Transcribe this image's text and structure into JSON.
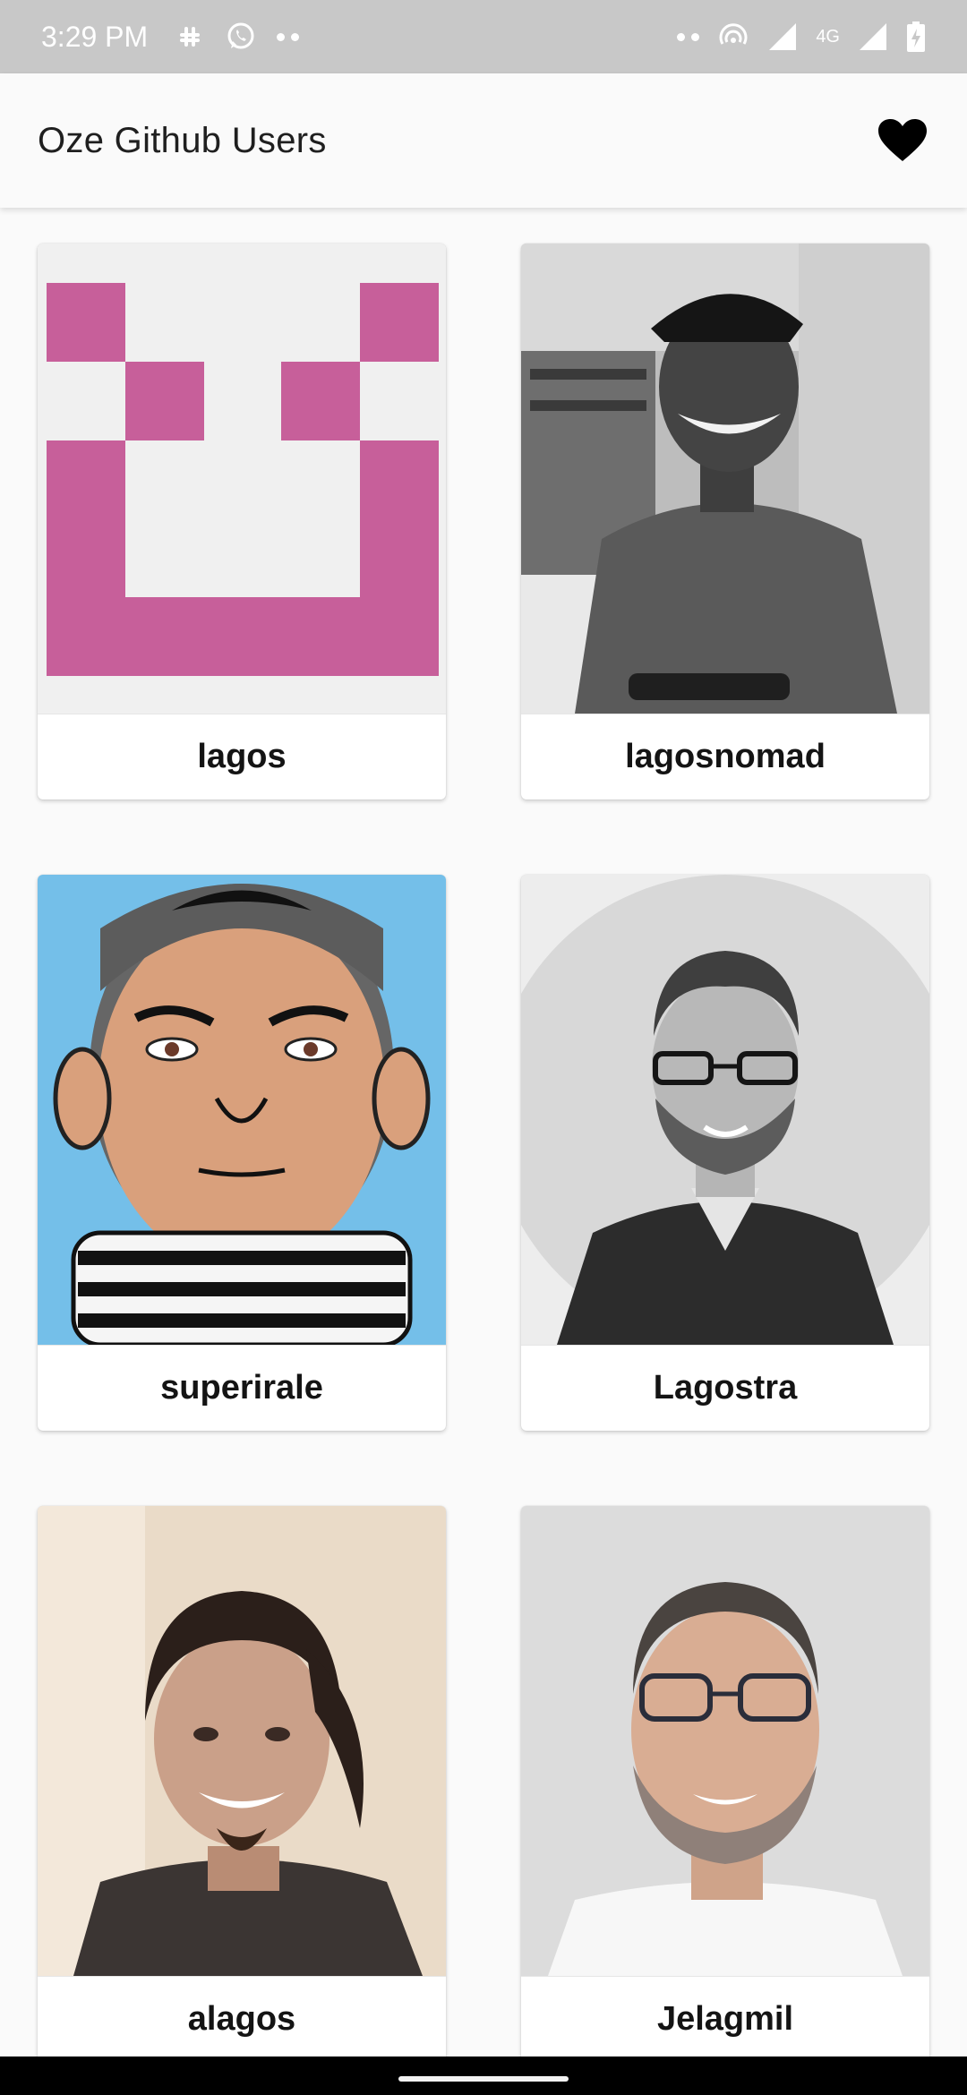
{
  "status_bar": {
    "time": "3:29 PM",
    "network_label": "4G",
    "icons": [
      "slack-icon",
      "whatsapp-icon",
      "more-notifications-icon",
      "more-icon",
      "hotspot-icon",
      "signal-icon",
      "signal-icon",
      "battery-icon"
    ]
  },
  "app_bar": {
    "title": "Oze Github Users",
    "favorites_icon": "heart-icon"
  },
  "users": [
    {
      "login": "lagos",
      "avatar": "identicon-avatar"
    },
    {
      "login": "lagosnomad",
      "avatar": "photo-avatar"
    },
    {
      "login": "superirale",
      "avatar": "cartoon-avatar"
    },
    {
      "login": "Lagostra",
      "avatar": "photo-avatar"
    },
    {
      "login": "alagos",
      "avatar": "photo-avatar"
    },
    {
      "login": "Jelagmil",
      "avatar": "photo-avatar"
    }
  ],
  "colors": {
    "identicon": "#c75f9a",
    "identicon_bg": "#f0f0f0",
    "status_bar": "#c8c8c8",
    "app_bar": "#fafafa"
  }
}
